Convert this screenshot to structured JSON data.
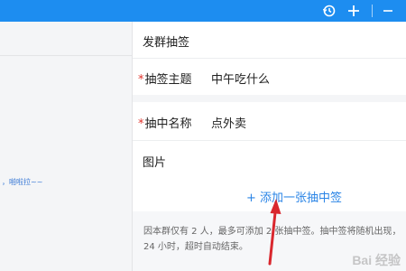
{
  "titlebar": {
    "icons": [
      "history-icon",
      "plus-icon",
      "minimize-icon"
    ]
  },
  "chat": {
    "message_fragment": "，啪啦拉~~"
  },
  "panel": {
    "header": "发群抽签",
    "topic": {
      "required_mark": "*",
      "label": "抽签主题",
      "value": "中午吃什么"
    },
    "winner": {
      "required_mark": "*",
      "label": "抽中名称",
      "value": "点外卖"
    },
    "image": {
      "label": "图片"
    },
    "add_link": "+ 添加一张抽中签",
    "hint_line1": "因本群仅有 2 人，最多可添加 2 张抽中签。抽中签将随机出现，",
    "hint_line2": "24 小时，超时自动结束。"
  },
  "annotation": {
    "color": "#d9272e"
  },
  "watermark": "Bai 经验"
}
